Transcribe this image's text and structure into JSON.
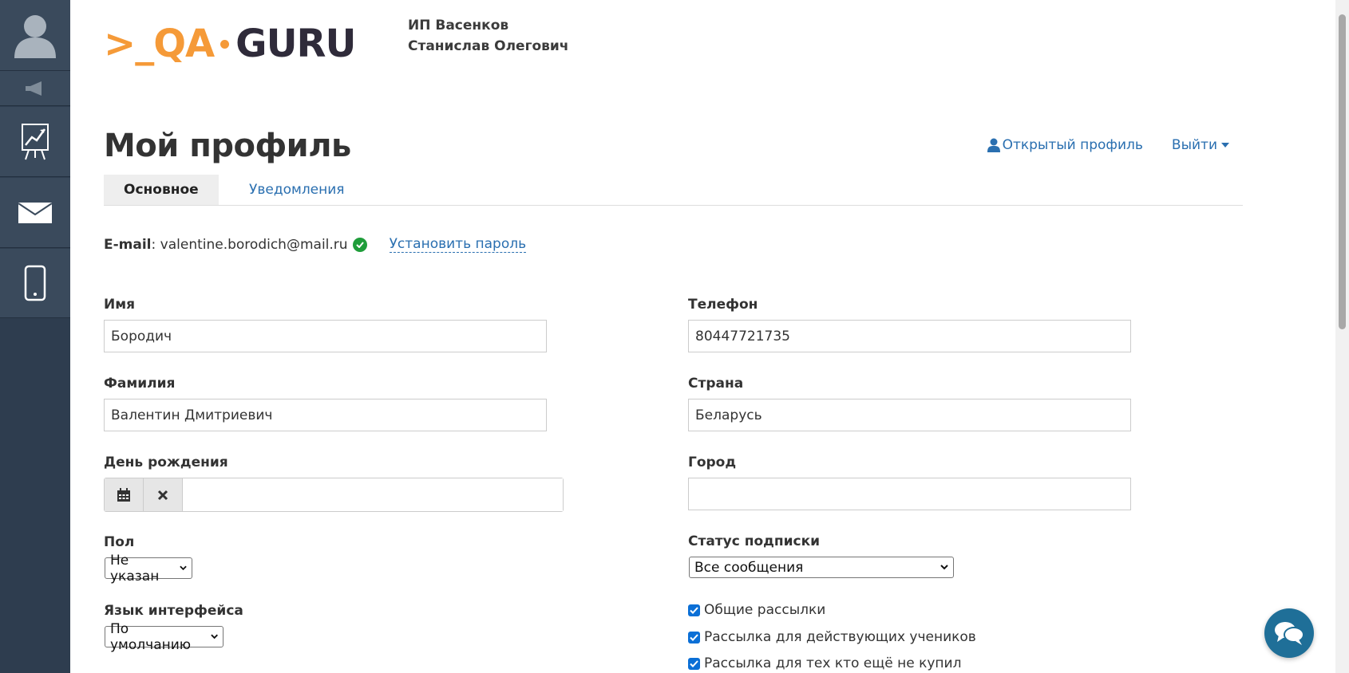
{
  "header": {
    "logo_text_left": ">_QA",
    "logo_text_right": "GURU",
    "company_line1": "ИП Васенков",
    "company_line2": "Станислав Олегович"
  },
  "page": {
    "title": "Мой профиль",
    "public_profile_link": "Открытый профиль",
    "logout_link": "Выйти"
  },
  "tabs": [
    {
      "label": "Основное",
      "active": true
    },
    {
      "label": "Уведомления",
      "active": false
    }
  ],
  "email": {
    "label": "E-mail",
    "value": "valentine.borodich@mail.ru",
    "set_password": "Установить пароль"
  },
  "form": {
    "first_name": {
      "label": "Имя",
      "value": "Бородич"
    },
    "last_name": {
      "label": "Фамилия",
      "value": "Валентин Дмитриевич"
    },
    "birthday": {
      "label": "День рождения",
      "value": ""
    },
    "gender": {
      "label": "Пол",
      "value": "Не указан"
    },
    "language": {
      "label": "Язык интерфейса",
      "value": "По умолчанию"
    },
    "phone": {
      "label": "Телефон",
      "value": "80447721735"
    },
    "country": {
      "label": "Страна",
      "value": "Беларусь"
    },
    "city": {
      "label": "Город",
      "value": ""
    },
    "subscription": {
      "label": "Статус подписки",
      "value": "Все сообщения"
    },
    "mailings": [
      {
        "label": "Общие рассылки",
        "checked": true
      },
      {
        "label": "Рассылка для действующих учеников",
        "checked": true
      },
      {
        "label": "Рассылка для тех кто ещё не купил",
        "checked": true
      }
    ]
  },
  "colors": {
    "sidebar": "#2e3d4f",
    "link": "#2a6fb0",
    "logo_accent": "#f59a38",
    "checkbox": "#0b6fd6",
    "verified": "#1f9d3a",
    "chat_button": "#1f6f98"
  },
  "icons": {
    "sidebar": [
      "avatar-icon",
      "megaphone-icon",
      "chart-icon",
      "mail-icon",
      "mobile-icon"
    ],
    "chat": "chat-icon"
  }
}
